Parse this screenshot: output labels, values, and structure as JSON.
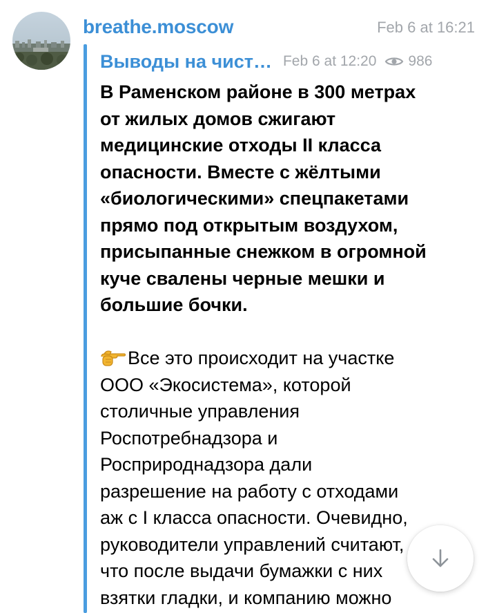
{
  "header": {
    "channel_name": "breathe.moscow",
    "post_time": "Feb 6 at 16:21",
    "avatar_icon": "city-skyline-photo-icon"
  },
  "forward": {
    "source_name": "Выводы на чист…",
    "date": "Feb 6 at 12:20",
    "views_icon": "eye-icon",
    "views": "986"
  },
  "message": {
    "bold_lines": [
      "В Раменском районе в 300 метрах",
      "от жилых домов сжигают",
      "медицинские  отходы II класса",
      "опасности. Вместе с жёлтыми",
      "«биологическими» спецпакетами",
      "прямо под открытым воздухом,",
      "присыпанные снежком в огромной",
      "куче свалены черные мешки и",
      "большие бочки."
    ],
    "regular_lines": [
      "Все это происходит на участке",
      "ООО «Экосистема», которой",
      "столичные управления",
      "Роспотребнадзора и",
      "Росприроднадзора дали",
      "разрешение на работу с отходами",
      "аж с I класса опасности. Очевидно,",
      "руководители управлений считают,",
      "что после выдачи бумажки с них",
      "взятки гладки, и компанию можно"
    ],
    "leading_icon": "pointing-hand-emoji-icon"
  },
  "scroll_button": {
    "icon": "arrow-down-icon"
  },
  "colors": {
    "accent": "#3c8fd6",
    "forward_bar": "#4a9de0",
    "meta_text": "#a2a6ab",
    "body_text": "#000000"
  }
}
